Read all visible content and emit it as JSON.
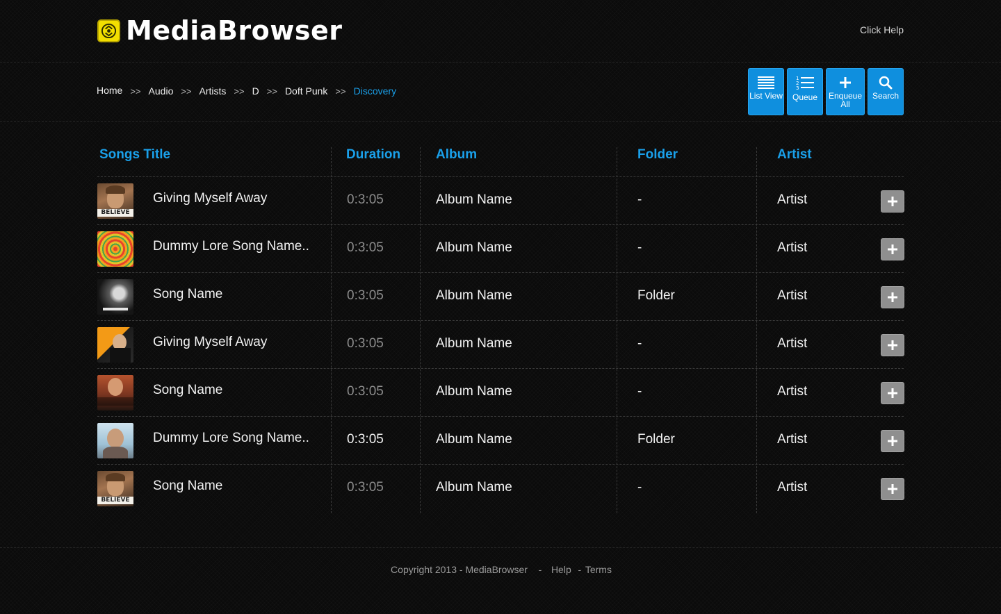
{
  "header": {
    "app_title": "MediaBrowser",
    "help_link": "Click Help"
  },
  "breadcrumb": {
    "items": [
      "Home",
      "Audio",
      "Artists",
      "D",
      "Doft Punk",
      "Discovery"
    ],
    "separator": ">>"
  },
  "toolbar": {
    "list_view": "List View",
    "queue": "Queue",
    "enqueue_all": "Enqueue All",
    "search": "Search"
  },
  "table": {
    "headers": {
      "title": "Songs Title",
      "duration": "Duration",
      "album": "Album",
      "folder": "Folder",
      "artist": "Artist"
    },
    "rows": [
      {
        "title": "Giving Myself Away",
        "duration": "0:3:05",
        "album": "Album Name",
        "folder": "-",
        "artist": "Artist",
        "thumb": "album-cover-believe"
      },
      {
        "title": "Dummy Lore Song Name..",
        "duration": "0:3:05",
        "album": "Album Name",
        "folder": "-",
        "artist": "Artist",
        "thumb": "album-cover-swirl"
      },
      {
        "title": "Song Name",
        "duration": "0:3:05",
        "album": "Album Name",
        "folder": "Folder",
        "artist": "Artist",
        "thumb": "album-cover-bw"
      },
      {
        "title": "Giving Myself Away",
        "duration": "0:3:05",
        "album": "Album Name",
        "folder": "-",
        "artist": "Artist",
        "thumb": "album-cover-michael-buble"
      },
      {
        "title": "Song Name",
        "duration": "0:3:05",
        "album": "Album Name",
        "folder": "-",
        "artist": "Artist",
        "thumb": "album-cover-joe-jonas"
      },
      {
        "title": "Dummy Lore Song Name..",
        "duration": "0:3:05",
        "album": "Album Name",
        "folder": "Folder",
        "artist": "Artist",
        "thumb": "album-cover-portrait"
      },
      {
        "title": "Song Name",
        "duration": "0:3:05",
        "album": "Album Name",
        "folder": "-",
        "artist": "Artist",
        "thumb": "album-cover-believe"
      }
    ]
  },
  "footer": {
    "copyright": "Copyright 2013 - MediaBrowser",
    "dash1": "-",
    "help": "Help",
    "dash2": "-",
    "terms": "Terms"
  },
  "colors": {
    "accent": "#1aa0ea",
    "toolbar_button": "#0f8fde",
    "logo_yellow": "#f2de00",
    "add_button": "#8f8f8f",
    "background": "#0b0b0b"
  }
}
